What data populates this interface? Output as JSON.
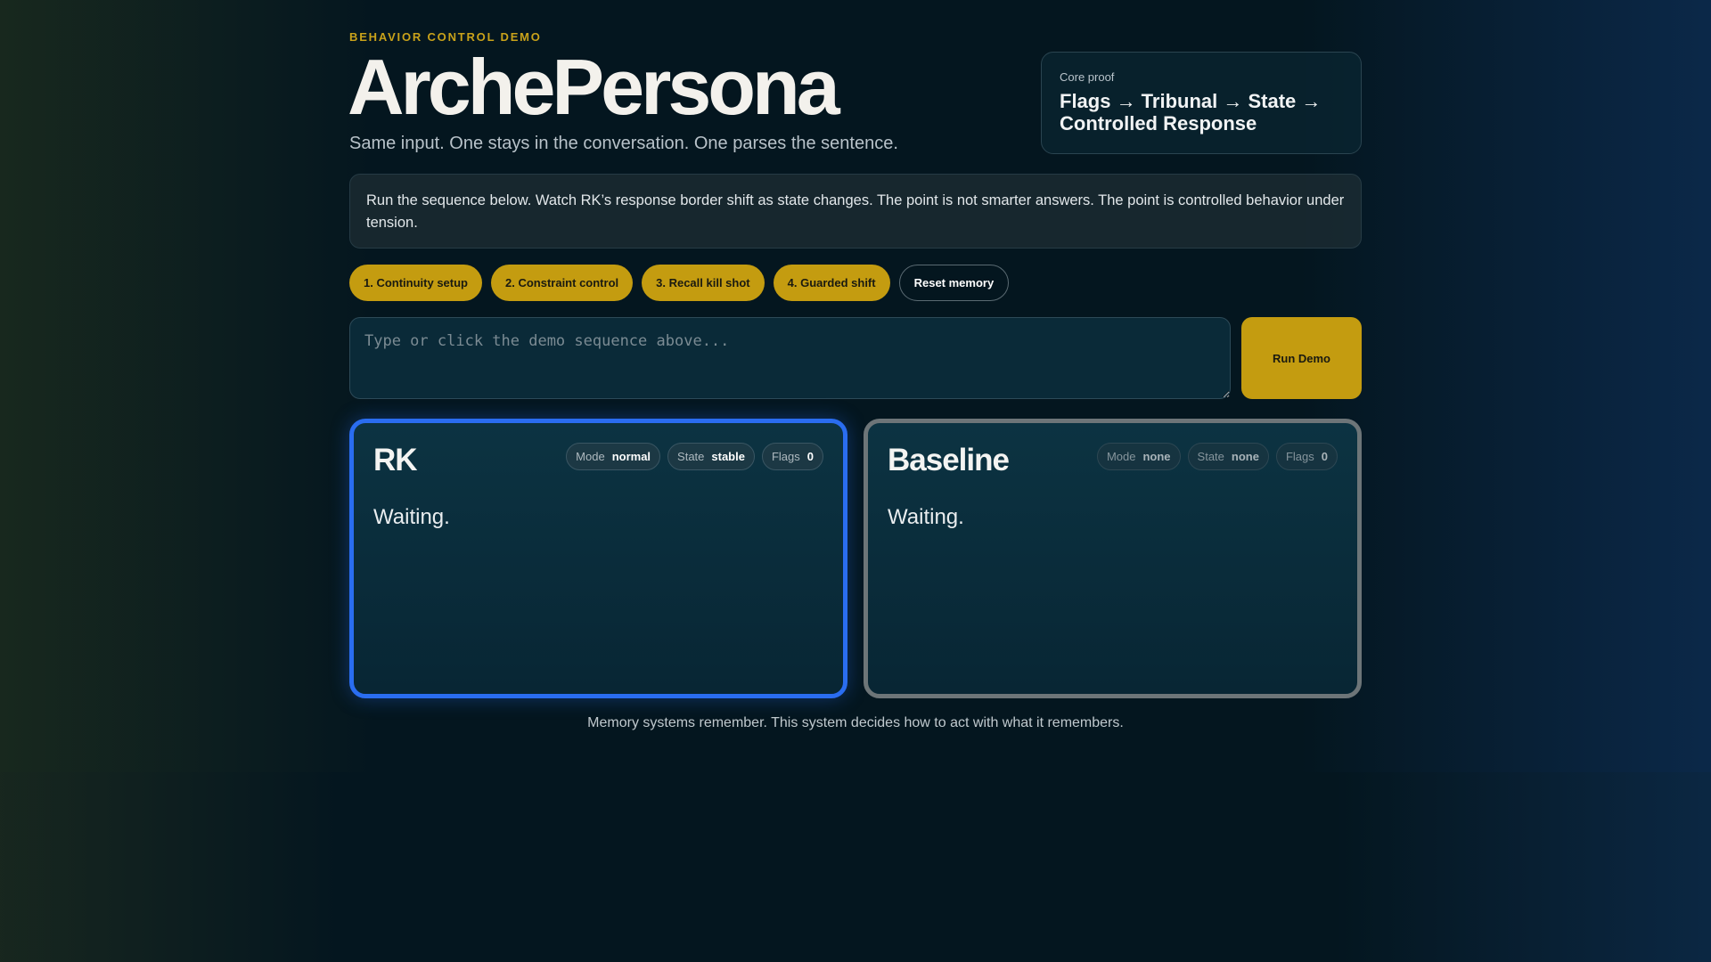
{
  "header": {
    "eyebrow": "BEHAVIOR CONTROL DEMO",
    "title": "ArchePersona",
    "tagline": "Same input. One stays in the conversation. One parses the sentence."
  },
  "core_proof": {
    "label": "Core proof",
    "text": "Flags → Tribunal → State → Controlled Response"
  },
  "instructions": "Run the sequence below. Watch RK’s response border shift as state changes. The point is not smarter answers. The point is controlled behavior under tension.",
  "sequence": {
    "steps": [
      "1. Continuity setup",
      "2. Constraint control",
      "3. Recall kill shot",
      "4. Guarded shift"
    ],
    "reset_label": "Reset memory"
  },
  "input": {
    "placeholder": "Type or click the demo sequence above...",
    "value": "",
    "run_label": "Run Demo"
  },
  "panels": {
    "rk": {
      "title": "RK",
      "mode_label": "Mode",
      "mode_value": "normal",
      "state_label": "State",
      "state_value": "stable",
      "flags_label": "Flags",
      "flags_value": "0",
      "response": "Waiting.",
      "border_color": "#2a6df0"
    },
    "baseline": {
      "title": "Baseline",
      "mode_label": "Mode",
      "mode_value": "none",
      "state_label": "State",
      "state_value": "none",
      "flags_label": "Flags",
      "flags_value": "0",
      "response": "Waiting.",
      "border_color": "#6d7578"
    }
  },
  "footer": "Memory systems remember. This system decides how to act with what it remembers.",
  "colors": {
    "accent": "#c49c10",
    "background": "#04161f"
  }
}
